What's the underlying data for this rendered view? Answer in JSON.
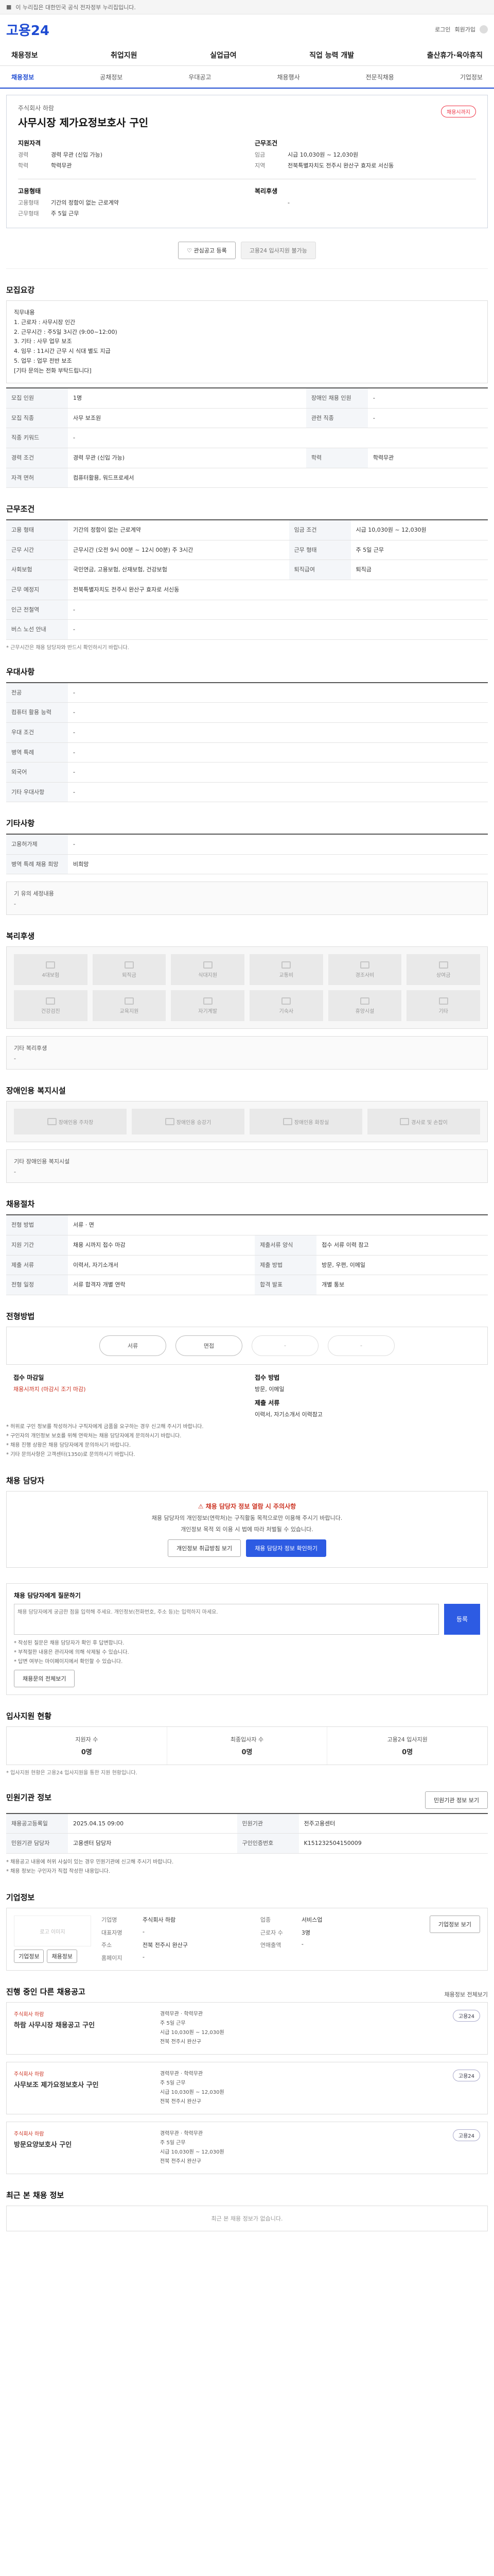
{
  "topbar": {
    "text": "이 누리집은 대한민국 공식 전자정부 누리집입니다."
  },
  "header": {
    "logo": "고용24",
    "util_login": "로그인",
    "util_join": "회원가입"
  },
  "nav": [
    "채용정보",
    "취업지원",
    "실업급여",
    "직업 능력 개발",
    "출산휴가·육아휴직"
  ],
  "subnav": [
    "채용정보",
    "공채정보",
    "우대공고",
    "채용행사",
    "전문직채용",
    "기업정보"
  ],
  "summary": {
    "company": "주식회사 하람",
    "title": "사무시장 제가요정보호사 구인",
    "badge": "채용시까지",
    "left_label": "지원자격",
    "left_rows": [
      {
        "k": "경력",
        "v": "경력 무관 (신입 가능)"
      },
      {
        "k": "학력",
        "v": "학력무관"
      }
    ],
    "right_label": "근무조건",
    "right_rows": [
      {
        "k": "임금",
        "v": "시급 10,030원 ~ 12,030원"
      },
      {
        "k": "지역",
        "v": "전북특별자치도 전주시 완산구 효자로 서신동"
      }
    ],
    "bottom_left_label": "고용형태",
    "bottom_left_rows": [
      {
        "k": "고용형태",
        "v": "기간의 정함이 없는 근로계약"
      },
      {
        "k": "근무형태",
        "v": "주 5일 근무"
      }
    ],
    "bottom_right_label": "복리후생",
    "bottom_right_rows": [
      {
        "k": "",
        "v": "-"
      }
    ]
  },
  "actions": {
    "favorite": "관심공고 등록",
    "apply": "고용24 입사지원 불가능"
  },
  "section_recruit": {
    "title": "모집요강",
    "desc": "직무내용\n1. 근로자 : 사무시장 인간\n2. 근무시간 : 주5일 3시간 (9:00~12:00)\n3. 기타 : 사무 업무 보조\n4. 임무 : 11시간 근무 시 식대 별도 지급\n5. 업무 : 업무 전반 보조\n[기타 문의는 전화 부탁드립니다]",
    "rows": [
      {
        "k": "모집 인원",
        "v": "1명",
        "k2": "장애인 채용 인원",
        "v2": "-"
      },
      {
        "k": "모집 직종",
        "v": "사무 보조원",
        "k2": "관련 직종",
        "v2": "-"
      },
      {
        "k": "직종 키워드",
        "v": "-",
        "k2": "",
        "v2": ""
      },
      {
        "k": "경력 조건",
        "v": "경력 무관 (신입 가능)",
        "k2": "학력",
        "v2": "학력무관"
      },
      {
        "k": "자격 면허",
        "v": "컴퓨터활용, 워드프로세서",
        "k2": "",
        "v2": ""
      }
    ]
  },
  "section_work": {
    "title": "근무조건",
    "rows": [
      {
        "k": "고용 형태",
        "v": "기간의 정함이 없는 근로계약",
        "k2": "임금 조건",
        "v2": "시급 10,030원 ~ 12,030원"
      },
      {
        "k": "근무 시간",
        "v": "근무시간 (오전 9시 00분 ~ 12시 00분) 주 3시간",
        "k2": "근무 형태",
        "v2": "주 5일 근무"
      },
      {
        "k": "사회보험",
        "v": "국민연금, 고용보험, 산재보험, 건강보험",
        "k2": "퇴직급여",
        "v2": "퇴직금"
      },
      {
        "k": "근무 예정지",
        "v": "전북특별자치도 전주시 완산구 효자로 서신동",
        "k2": "",
        "v2": ""
      },
      {
        "k": "인근 전철역",
        "v": "-",
        "k2": "",
        "v2": ""
      },
      {
        "k": "버스 노선 안내",
        "v": "-",
        "k2": "",
        "v2": ""
      }
    ],
    "note": "* 근무시간은 채용 담당자와 반드시 확인하시기 바랍니다."
  },
  "section_pref": {
    "title": "우대사항",
    "rows": [
      {
        "k": "전공",
        "v": "-"
      },
      {
        "k": "컴퓨터 활용 능력",
        "v": "-"
      },
      {
        "k": "우대 조건",
        "v": "-"
      },
      {
        "k": "병역 특례",
        "v": "-"
      },
      {
        "k": "외국어",
        "v": "-"
      },
      {
        "k": "기타 우대사항",
        "v": "-"
      }
    ]
  },
  "section_etc": {
    "title": "기타사항",
    "rows": [
      {
        "k": "고용허가제",
        "v": "-"
      },
      {
        "k": "병역 특례 채용 희망",
        "v": "비희망"
      }
    ],
    "box": "기 유의 세정내용",
    "box_value": "-"
  },
  "section_welfare": {
    "title": "복리후생",
    "tiles": [
      "4대보험",
      "퇴직금",
      "식대지원",
      "교통비",
      "경조사비",
      "상여금",
      "건강검진",
      "교육지원",
      "자기계발",
      "기숙사",
      "휴양시설",
      "기타"
    ],
    "box": "기타 복리후생",
    "box_value": "-"
  },
  "section_disabled": {
    "title": "장애인용 복지시설",
    "tiles": [
      "장애인용 주차장",
      "장애인용 승강기",
      "장애인용 화장실",
      "경사로 및 손잡이"
    ],
    "box": "기타 장애인용 복지시설",
    "box_value": "-"
  },
  "section_period": {
    "title": "채용절차",
    "rows": [
      {
        "k": "전형 방법",
        "v": "서류 · 면",
        "k2": "",
        "v2": ""
      },
      {
        "k": "지원 기간",
        "v": "채용 시까지 접수 마감",
        "k2": "제출서류 양식",
        "v2": "접수 서류 이력 참고"
      },
      {
        "k": "제출 서류",
        "v": "이력서, 자기소개서",
        "k2": "제출 방법",
        "v2": "방문, 우편, 이메일"
      },
      {
        "k": "전형 일정",
        "v": "서류 합격자 개별 연락",
        "k2": "합격 발표",
        "v2": "개별 통보"
      }
    ]
  },
  "section_process": {
    "title": "전형방법",
    "steps": [
      "서류",
      "면접",
      "-",
      "-"
    ],
    "info_left_label": "접수 마감일",
    "info_left_value": "채용시까지 (마감시 조기 마감)",
    "info_right_label": "접수 방법",
    "info_right_value": "방문, 이메일",
    "info_right_label2": "제출 서류",
    "info_right_value2": "이력서, 자기소개서 이력참고",
    "bullets": [
      "* 허위로 구인 정보를 작성하거나 구직자에게 금품을 요구하는 경우 신고해 주시기 바랍니다.",
      "* 구인자의 개인정보 보호를 위해 연락처는 채용 담당자에게 문의하시기 바랍니다.",
      "* 채용 진행 상황은 채용 담당자에게 문의하시기 바랍니다.",
      "* 기타 문의사항은 고객센터(1350)로 문의하시기 바랍니다."
    ]
  },
  "section_contact": {
    "title": "채용 담당자",
    "warn": "채용 담당자 정보 열람 시 주의사항",
    "msg1": "채용 담당자의 개인정보(연락처)는 구직활동 목적으로만 이용해 주시기 바랍니다.",
    "msg2": "개인정보 목적 외 이용 시 법에 따라 처벌될 수 있습니다.",
    "btn1": "개인정보 취급방침 보기",
    "btn2": "채용 담당자 정보 확인하기"
  },
  "section_qna": {
    "title": "채용 담당자에게 질문하기",
    "placeholder": "채용 담당자에게 궁금한 점을 입력해 주세요. 개인정보(전화번호, 주소 등)는 입력하지 마세요.",
    "register": "등록",
    "notes": [
      "* 작성된 질문은 채용 담당자가 확인 후 답변합니다.",
      "* 부적절한 내용은 관리자에 의해 삭제될 수 있습니다.",
      "* 답변 여부는 마이페이지에서 확인할 수 있습니다."
    ],
    "more": "채용문의 전체보기"
  },
  "section_stats": {
    "title": "입사지원 현황",
    "items": [
      {
        "t": "지원자 수",
        "n": "0명"
      },
      {
        "t": "최종입사자 수",
        "n": "0명"
      },
      {
        "t": "고용24 입사지원",
        "n": "0명"
      }
    ],
    "note": "* 입사지원 현황은 고용24 입사지원을 통한 지원 현황입니다."
  },
  "section_manage": {
    "title": "민원기관 정보",
    "more": "민원기관 정보 보기",
    "rows": [
      {
        "k": "채용공고등록일",
        "v": "2025.04.15 09:00",
        "k2": "민원기관",
        "v2": "전주고용센터"
      },
      {
        "k": "민원기관 담당자",
        "v": "고용센터 담당자",
        "k2": "구인인증번호",
        "v2": "K151232504150009"
      }
    ],
    "notes": [
      "* 채용공고 내용에 허위 사실이 있는 경우 민원기관에 신고해 주시기 바랍니다.",
      "* 채용 정보는 구인자가 직접 작성한 내용입니다."
    ]
  },
  "section_company": {
    "title": "기업정보",
    "logo": "로고 이미지",
    "btn1": "기업정보",
    "btn2": "채용정보",
    "info": [
      {
        "k": "기업명",
        "v": "주식회사 하람"
      },
      {
        "k": "업종",
        "v": "서비스업"
      },
      {
        "k": "대표자명",
        "v": "-"
      },
      {
        "k": "근로자 수",
        "v": "3명"
      },
      {
        "k": "주소",
        "v": "전북 전주시 완산구"
      },
      {
        "k": "연매출액",
        "v": "-"
      },
      {
        "k": "홈페이지",
        "v": "-"
      },
      {
        "k": "",
        "v": ""
      }
    ],
    "more": "기업정보 보기"
  },
  "section_other": {
    "title": "진행 중인 다른 채용공고",
    "more": "채용정보 전체보기",
    "jobs": [
      {
        "corp": "주식회사 하람",
        "title": "하람 사무시장 채용공고 구인",
        "info": [
          "경력무관 · 학력무관",
          "주 5일 근무",
          "시급 10,030원 ~ 12,030원",
          "전북 전주시 완산구"
        ],
        "tag": "고용24"
      },
      {
        "corp": "주식회사 하람",
        "title": "사무보조 제가요정보호사 구인",
        "info": [
          "경력무관 · 학력무관",
          "주 5일 근무",
          "시급 10,030원 ~ 12,030원",
          "전북 전주시 완산구"
        ],
        "tag": "고용24"
      },
      {
        "corp": "주식회사 하람",
        "title": "방문요양보호사 구인",
        "info": [
          "경력무관 · 학력무관",
          "주 5일 근무",
          "시급 10,030원 ~ 12,030원",
          "전북 전주시 완산구"
        ],
        "tag": "고용24"
      }
    ]
  },
  "section_recent": {
    "title": "최근 본 채용 정보",
    "empty": "최근 본 채용 정보가 없습니다."
  }
}
